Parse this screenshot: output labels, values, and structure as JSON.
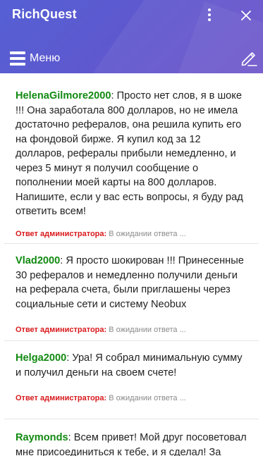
{
  "app": {
    "title": "RichQuest"
  },
  "toolbar": {
    "menu_label": "Меню"
  },
  "posts": [
    {
      "author": "HelenaGilmore2000",
      "text": "Просто нет слов, я в шоке !!! Она заработала 800 долларов, но не имела достаточно рефералов, она решила купить его на фондовой бирже. Я купил код за 12 долларов, рефералы прибыли немедленно, и через 5 минут я получил сообщение о пополнении моей карты на 800 долларов. Напишите, если у вас есть вопросы, я буду рад ответить всем!",
      "admin_label": "Ответ администратора:",
      "admin_status": "В ожидании ответа ..."
    },
    {
      "author": "Vlad2000",
      "text": "Я просто шокирован !!! Принесенные 30 рефералов и немедленно получили деньги на реферала счета, были приглашены через социальные сети и систему Neobux",
      "admin_label": "Ответ администратора:",
      "admin_status": "В ожидании ответа ..."
    },
    {
      "author": "Helga2000",
      "text": "Ура! Я собрал минимальную сумму и получил деньги на своем счете!",
      "admin_label": "Ответ администратора:",
      "admin_status": "В ожидании ответа ..."
    },
    {
      "author": "Raymonds",
      "text": "Всем привет! Мой друг посоветовал мне присоединиться к тебе, и я сделал! За"
    }
  ],
  "colors": {
    "header_start": "#5560d4",
    "header_end": "#6a4fc8",
    "author": "#128a12",
    "admin_label": "#d8191c",
    "admin_status": "#8a8a8a"
  },
  "icons": {
    "menu": "hamburger-icon",
    "more": "kebab-icon",
    "close": "close-icon",
    "edit": "pencil-icon"
  }
}
